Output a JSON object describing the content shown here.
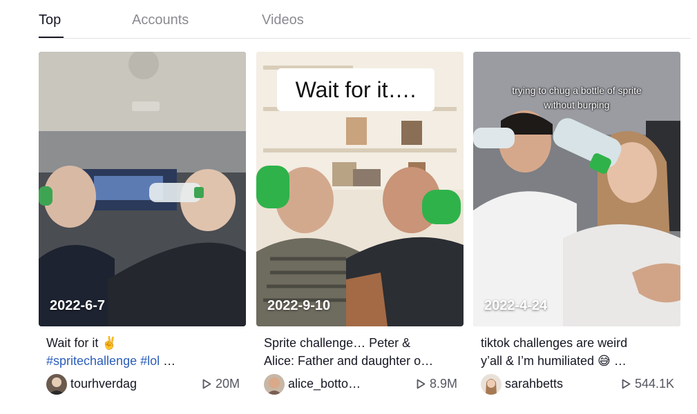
{
  "tabs": [
    {
      "label": "Top",
      "active": true
    },
    {
      "label": "Accounts",
      "active": false
    },
    {
      "label": "Videos",
      "active": false
    }
  ],
  "videos": [
    {
      "date": "2022-6-7",
      "caption_line1": "Wait for it ✌️",
      "caption_tags": "#spritechallenge #lol",
      "caption_more": "…",
      "username": "tourhverdag",
      "views": "20M",
      "overlay_text": ""
    },
    {
      "date": "2022-9-10",
      "caption_line1": "Sprite challenge… Peter &",
      "caption_line2": "Alice: Father and daughter o…",
      "username": "alice_botto…",
      "views": "8.9M",
      "overlay_text": "Wait for it…."
    },
    {
      "date": "2022-4-24",
      "caption_line1": "tiktok challenges are weird",
      "caption_line2": "y’all & I’m humiliated 😅 …",
      "username": "sarahbetts",
      "views": "544.1K",
      "overlay_text": "trying to chug a bottle of sprite without burping"
    }
  ],
  "icons": {
    "views": "play-outline-icon"
  },
  "colors": {
    "active_tab": "#161823",
    "inactive_tab": "#8a8b91",
    "hashtag": "#2b5db9",
    "sprite_green": "#2fb24a"
  }
}
